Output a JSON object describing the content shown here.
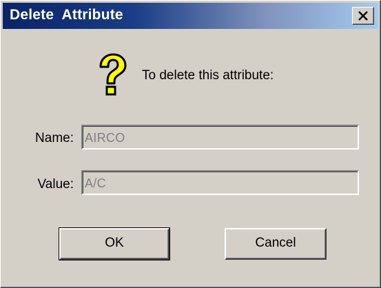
{
  "window": {
    "title": "Delete  Attribute",
    "close_icon": "close-x-icon"
  },
  "prompt": {
    "icon": "question-mark-icon",
    "text": "To delete this attribute:"
  },
  "fields": {
    "name_label": "Name:",
    "name_value": "AIRCO",
    "value_label": "Value:",
    "value_value": "A/C"
  },
  "buttons": {
    "ok_label": "OK",
    "cancel_label": "Cancel"
  },
  "colors": {
    "titlebar_start": "#0a246a",
    "titlebar_end": "#a6caf0",
    "dialog_face": "#d4d0c8",
    "disabled_text": "#808080",
    "icon_yellow": "#ffff00"
  }
}
